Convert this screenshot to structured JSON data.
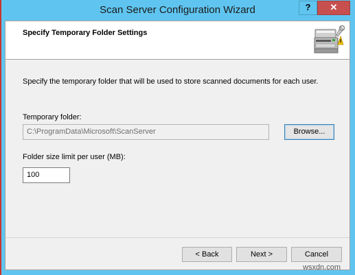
{
  "window": {
    "title": "Scan Server Configuration Wizard",
    "help_label": "?",
    "close_label": "✕"
  },
  "header": {
    "title": "Specify Temporary Folder Settings",
    "icon": "scanner-settings-icon"
  },
  "main": {
    "description": "Specify the temporary folder that will be used to store scanned documents for each user.",
    "temp_folder_label": "Temporary folder:",
    "temp_folder_value": "C:\\ProgramData\\Microsoft\\ScanServer",
    "browse_label": "Browse...",
    "size_limit_label": "Folder size limit per user (MB):",
    "size_limit_value": "100"
  },
  "footer": {
    "back_label": "< Back",
    "next_label": "Next >",
    "cancel_label": "Cancel"
  },
  "watermark": "wsxdn.com",
  "colors": {
    "titlebar": "#5fc5f0",
    "close_button": "#c7504f",
    "dialog_bg": "#f0f0f0",
    "header_bg": "#ffffff"
  }
}
